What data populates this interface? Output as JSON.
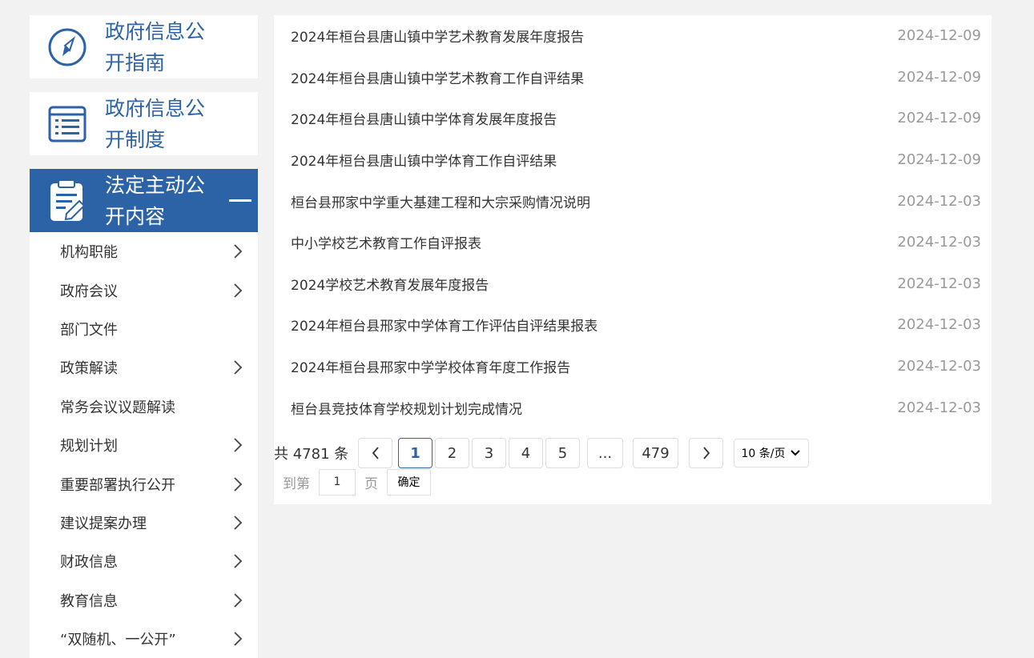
{
  "sidebar": {
    "cards": [
      {
        "title": "政府信息公开指南",
        "icon": "compass-icon"
      },
      {
        "title": "政府信息公开制度",
        "icon": "list-document-icon"
      },
      {
        "title": "法定主动公开内容",
        "icon": "clipboard-edit-icon"
      }
    ],
    "submenu": [
      {
        "label": "机构职能",
        "arrow": true
      },
      {
        "label": "政府会议",
        "arrow": true
      },
      {
        "label": "部门文件",
        "arrow": false
      },
      {
        "label": "政策解读",
        "arrow": true
      },
      {
        "label": "常务会议议题解读",
        "arrow": false
      },
      {
        "label": "规划计划",
        "arrow": true
      },
      {
        "label": "重要部署执行公开",
        "arrow": true
      },
      {
        "label": "建议提案办理",
        "arrow": true
      },
      {
        "label": "财政信息",
        "arrow": true
      },
      {
        "label": "教育信息",
        "arrow": true
      },
      {
        "label": "“双随机、一公开”",
        "arrow": true
      }
    ]
  },
  "list": [
    {
      "title": "2024年桓台县唐山镇中学艺术教育发展年度报告",
      "date": "2024-12-09"
    },
    {
      "title": "2024年桓台县唐山镇中学艺术教育工作自评结果",
      "date": "2024-12-09"
    },
    {
      "title": "2024年桓台县唐山镇中学体育发展年度报告",
      "date": "2024-12-09"
    },
    {
      "title": "2024年桓台县唐山镇中学体育工作自评结果",
      "date": "2024-12-09"
    },
    {
      "title": "桓台县邢家中学重大基建工程和大宗采购情况说明",
      "date": "2024-12-03"
    },
    {
      "title": "中小学校艺术教育工作自评报表",
      "date": "2024-12-03"
    },
    {
      "title": "2024学校艺术教育发展年度报告",
      "date": "2024-12-03"
    },
    {
      "title": "2024年桓台县邢家中学体育工作评估自评结果报表",
      "date": "2024-12-03"
    },
    {
      "title": "2024年桓台县邢家中学学校体育年度工作报告",
      "date": "2024-12-03"
    },
    {
      "title": "桓台县竞技体育学校规划计划完成情况",
      "date": "2024-12-03"
    }
  ],
  "pager": {
    "total": "共 4781 条",
    "prev": "<",
    "pages": [
      "1",
      "2",
      "3",
      "4",
      "5"
    ],
    "ellipsis": "...",
    "last": "479",
    "next": ">",
    "size": "10 条/页",
    "goto_label": "到第",
    "goto_value": "1",
    "goto_suffix": "页",
    "confirm": "确定"
  },
  "colors": {
    "accent": "#2c62a6",
    "bg": "#f2f2f2"
  }
}
